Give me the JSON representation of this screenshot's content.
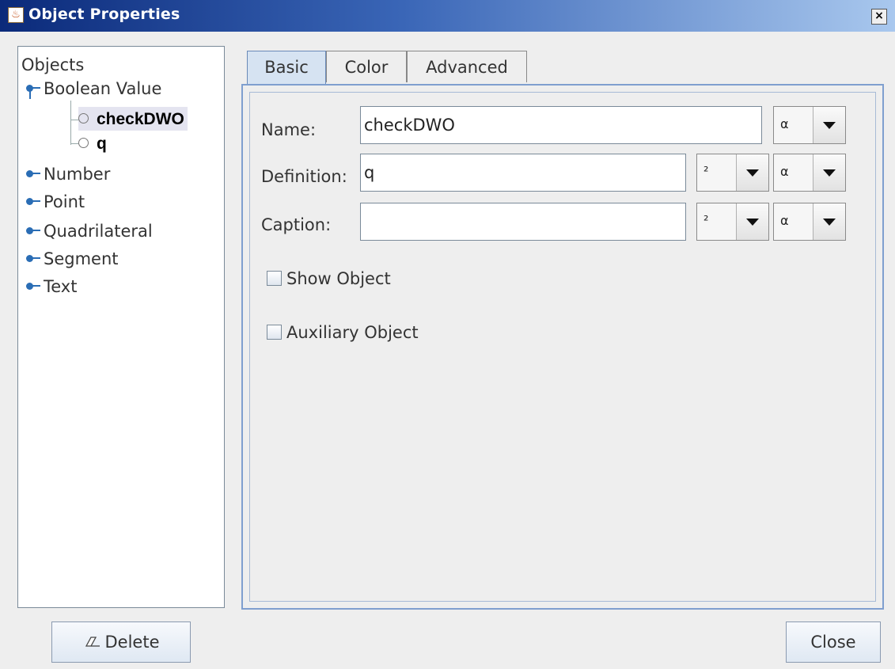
{
  "window": {
    "title": "Object Properties",
    "close_glyph": "×",
    "app_icon": "java-icon"
  },
  "tree": {
    "root": "Objects",
    "groups": [
      {
        "label": "Boolean Value",
        "children": [
          "checkDWO",
          "q"
        ]
      },
      {
        "label": "Number"
      },
      {
        "label": "Point"
      },
      {
        "label": "Quadrilateral"
      },
      {
        "label": "Segment"
      },
      {
        "label": "Text"
      }
    ],
    "selected": "checkDWO"
  },
  "tabs": [
    "Basic",
    "Color",
    "Advanced"
  ],
  "active_tab": "Basic",
  "basic": {
    "name_label": "Name:",
    "name_value": "checkDWO",
    "definition_label": "Definition:",
    "definition_value": "q",
    "caption_label": "Caption:",
    "caption_value": "",
    "alpha_glyph": "α",
    "superscript_glyph": "²",
    "show_object_label": "Show Object",
    "show_object_checked": false,
    "auxiliary_label": "Auxiliary Object",
    "auxiliary_checked": false
  },
  "buttons": {
    "delete": "Delete",
    "close": "Close"
  },
  "colors": {
    "title_start": "#0b2a7a",
    "title_end": "#a9c8ee",
    "tab_active": "#d6e3f2",
    "tree_handle": "#2a6db5"
  }
}
